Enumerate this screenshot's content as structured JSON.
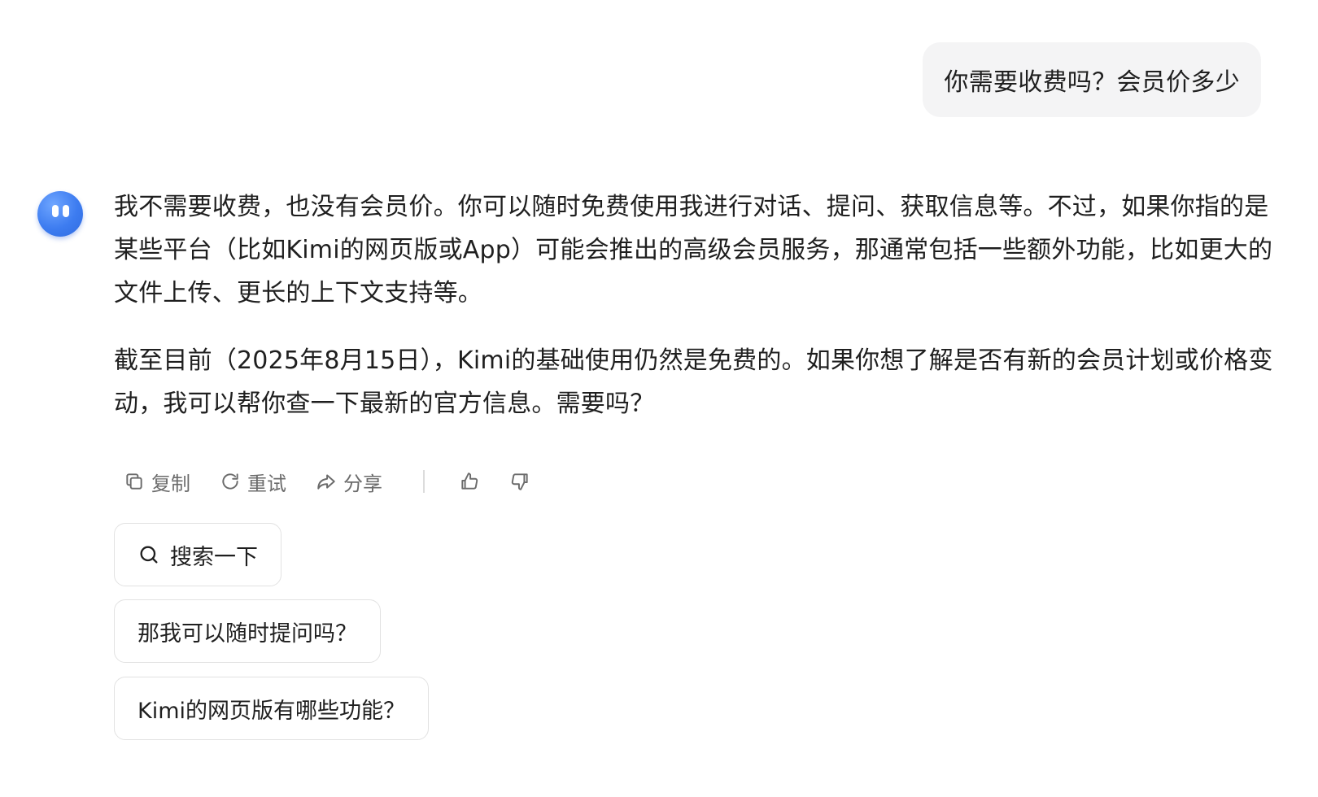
{
  "user_message": "你需要收费吗？会员价多少",
  "assistant": {
    "paragraphs": [
      "我不需要收费，也没有会员价。你可以随时免费使用我进行对话、提问、获取信息等。不过，如果你指的是某些平台（比如Kimi的网页版或App）可能会推出的高级会员服务，那通常包括一些额外功能，比如更大的文件上传、更长的上下文支持等。",
      "截至目前（2025年8月15日），Kimi的基础使用仍然是免费的。如果你想了解是否有新的会员计划或价格变动，我可以帮你查一下最新的官方信息。需要吗？"
    ]
  },
  "actions": {
    "copy_label": "复制",
    "retry_label": "重试",
    "share_label": "分享",
    "copy_icon": "copy-icon",
    "retry_icon": "refresh-icon",
    "share_icon": "share-icon",
    "like_icon": "thumbs-up-icon",
    "dislike_icon": "thumbs-down-icon"
  },
  "suggestions": [
    "搜索一下",
    "那我可以随时提问吗？",
    "Kimi的网页版有哪些功能？"
  ],
  "colors": {
    "user_bubble_bg": "#f4f4f5",
    "avatar": "#3d7cf0",
    "muted_text": "#6b6b6b"
  }
}
